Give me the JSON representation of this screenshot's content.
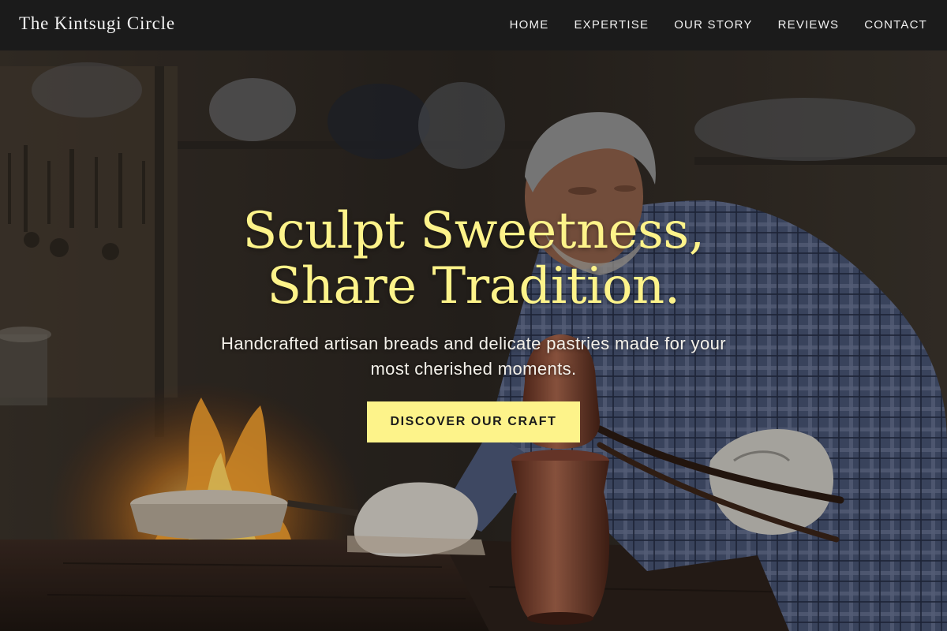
{
  "navbar": {
    "brand": "The Kintsugi Circle",
    "links": [
      {
        "label": "HOME"
      },
      {
        "label": "EXPERTISE"
      },
      {
        "label": "OUR STORY"
      },
      {
        "label": "REVIEWS"
      },
      {
        "label": "CONTACT"
      }
    ]
  },
  "hero": {
    "title_line1": "Sculpt Sweetness,",
    "title_line2": "Share Tradition.",
    "subtitle": "Handcrafted artisan breads and delicate pastries made for your most cherished moments.",
    "cta_label": "DISCOVER OUR CRAFT",
    "background_image": "artisan-workshop-photo"
  },
  "colors": {
    "accent": "#fdf38a",
    "navbar_bg": "#1b1b1b",
    "text_light": "#f4f1ea"
  }
}
